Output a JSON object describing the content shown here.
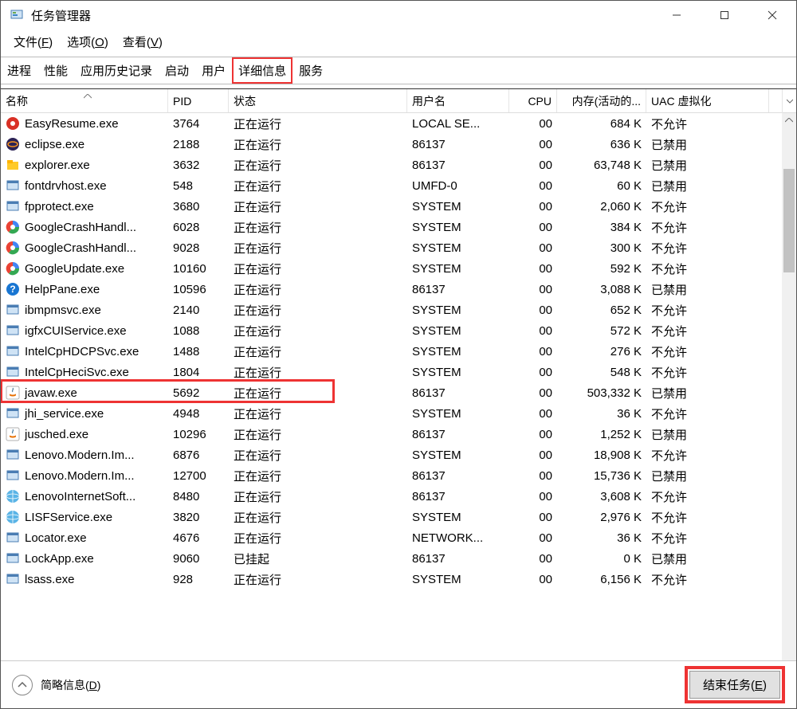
{
  "window": {
    "title": "任务管理器",
    "minimize": "—",
    "maximize": "□",
    "close": "✕"
  },
  "menu": {
    "file": "文件(F)",
    "options": "选项(O)",
    "view": "查看(V)"
  },
  "tabs": {
    "processes": "进程",
    "performance": "性能",
    "app_history": "应用历史记录",
    "startup": "启动",
    "users": "用户",
    "details": "详细信息",
    "services": "服务"
  },
  "columns": {
    "name": "名称",
    "pid": "PID",
    "status": "状态",
    "user": "用户名",
    "cpu": "CPU",
    "memory": "内存(活动的...",
    "uac": "UAC 虚拟化"
  },
  "rows": [
    {
      "icon": "red-disc",
      "name": "EasyResume.exe",
      "pid": "3764",
      "status": "正在运行",
      "user": "LOCAL SE...",
      "cpu": "00",
      "mem": "684 K",
      "uac": "不允许"
    },
    {
      "icon": "eclipse",
      "name": "eclipse.exe",
      "pid": "2188",
      "status": "正在运行",
      "user": "86137",
      "cpu": "00",
      "mem": "636 K",
      "uac": "已禁用"
    },
    {
      "icon": "folder",
      "name": "explorer.exe",
      "pid": "3632",
      "status": "正在运行",
      "user": "86137",
      "cpu": "00",
      "mem": "63,748 K",
      "uac": "已禁用"
    },
    {
      "icon": "app",
      "name": "fontdrvhost.exe",
      "pid": "548",
      "status": "正在运行",
      "user": "UMFD-0",
      "cpu": "00",
      "mem": "60 K",
      "uac": "已禁用"
    },
    {
      "icon": "app",
      "name": "fpprotect.exe",
      "pid": "3680",
      "status": "正在运行",
      "user": "SYSTEM",
      "cpu": "00",
      "mem": "2,060 K",
      "uac": "不允许"
    },
    {
      "icon": "google",
      "name": "GoogleCrashHandl...",
      "pid": "6028",
      "status": "正在运行",
      "user": "SYSTEM",
      "cpu": "00",
      "mem": "384 K",
      "uac": "不允许"
    },
    {
      "icon": "google",
      "name": "GoogleCrashHandl...",
      "pid": "9028",
      "status": "正在运行",
      "user": "SYSTEM",
      "cpu": "00",
      "mem": "300 K",
      "uac": "不允许"
    },
    {
      "icon": "google",
      "name": "GoogleUpdate.exe",
      "pid": "10160",
      "status": "正在运行",
      "user": "SYSTEM",
      "cpu": "00",
      "mem": "592 K",
      "uac": "不允许"
    },
    {
      "icon": "help",
      "name": "HelpPane.exe",
      "pid": "10596",
      "status": "正在运行",
      "user": "86137",
      "cpu": "00",
      "mem": "3,088 K",
      "uac": "已禁用"
    },
    {
      "icon": "app",
      "name": "ibmpmsvc.exe",
      "pid": "2140",
      "status": "正在运行",
      "user": "SYSTEM",
      "cpu": "00",
      "mem": "652 K",
      "uac": "不允许"
    },
    {
      "icon": "app",
      "name": "igfxCUIService.exe",
      "pid": "1088",
      "status": "正在运行",
      "user": "SYSTEM",
      "cpu": "00",
      "mem": "572 K",
      "uac": "不允许"
    },
    {
      "icon": "app",
      "name": "IntelCpHDCPSvc.exe",
      "pid": "1488",
      "status": "正在运行",
      "user": "SYSTEM",
      "cpu": "00",
      "mem": "276 K",
      "uac": "不允许"
    },
    {
      "icon": "app",
      "name": "IntelCpHeciSvc.exe",
      "pid": "1804",
      "status": "正在运行",
      "user": "SYSTEM",
      "cpu": "00",
      "mem": "548 K",
      "uac": "不允许"
    },
    {
      "icon": "java",
      "name": "javaw.exe",
      "pid": "5692",
      "status": "正在运行",
      "user": "86137",
      "cpu": "00",
      "mem": "503,332 K",
      "uac": "已禁用"
    },
    {
      "icon": "app",
      "name": "jhi_service.exe",
      "pid": "4948",
      "status": "正在运行",
      "user": "SYSTEM",
      "cpu": "00",
      "mem": "36 K",
      "uac": "不允许"
    },
    {
      "icon": "java",
      "name": "jusched.exe",
      "pid": "10296",
      "status": "正在运行",
      "user": "86137",
      "cpu": "00",
      "mem": "1,252 K",
      "uac": "已禁用"
    },
    {
      "icon": "app",
      "name": "Lenovo.Modern.Im...",
      "pid": "6876",
      "status": "正在运行",
      "user": "SYSTEM",
      "cpu": "00",
      "mem": "18,908 K",
      "uac": "不允许"
    },
    {
      "icon": "app",
      "name": "Lenovo.Modern.Im...",
      "pid": "12700",
      "status": "正在运行",
      "user": "86137",
      "cpu": "00",
      "mem": "15,736 K",
      "uac": "已禁用"
    },
    {
      "icon": "globe-b",
      "name": "LenovoInternetSoft...",
      "pid": "8480",
      "status": "正在运行",
      "user": "86137",
      "cpu": "00",
      "mem": "3,608 K",
      "uac": "不允许"
    },
    {
      "icon": "globe-b",
      "name": "LISFService.exe",
      "pid": "3820",
      "status": "正在运行",
      "user": "SYSTEM",
      "cpu": "00",
      "mem": "2,976 K",
      "uac": "不允许"
    },
    {
      "icon": "app",
      "name": "Locator.exe",
      "pid": "4676",
      "status": "正在运行",
      "user": "NETWORK...",
      "cpu": "00",
      "mem": "36 K",
      "uac": "不允许"
    },
    {
      "icon": "app",
      "name": "LockApp.exe",
      "pid": "9060",
      "status": "已挂起",
      "user": "86137",
      "cpu": "00",
      "mem": "0 K",
      "uac": "已禁用"
    },
    {
      "icon": "app",
      "name": "lsass.exe",
      "pid": "928",
      "status": "正在运行",
      "user": "SYSTEM",
      "cpu": "00",
      "mem": "6,156 K",
      "uac": "不允许"
    }
  ],
  "bottom": {
    "less_details": "简略信息(D)",
    "end_task": "结束任务(E)"
  }
}
